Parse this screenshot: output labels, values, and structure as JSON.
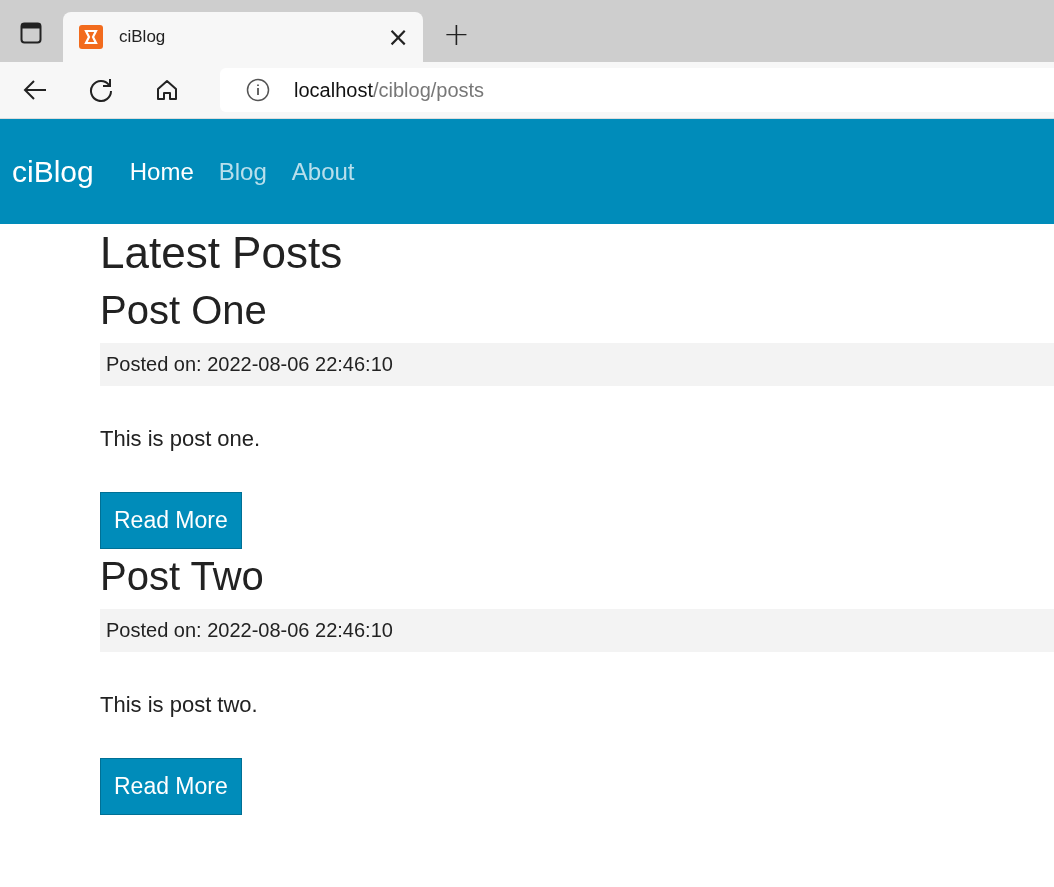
{
  "browser": {
    "tab": {
      "title": "ciBlog",
      "close": "×"
    },
    "new_tab": "+",
    "address": {
      "host": "localhost",
      "path": "/ciblog/posts"
    }
  },
  "navbar": {
    "brand": "ciBlog",
    "links": [
      {
        "label": "Home",
        "selected": true
      },
      {
        "label": "Blog",
        "selected": false
      },
      {
        "label": "About",
        "selected": false
      }
    ]
  },
  "heading": "Latest Posts",
  "posts": [
    {
      "title": "Post One",
      "posted": "Posted on: 2022-08-06 22:46:10",
      "body": "This is post one.",
      "button": "Read More"
    },
    {
      "title": "Post Two",
      "posted": "Posted on: 2022-08-06 22:46:10",
      "body": "This is post two.",
      "button": "Read More"
    }
  ]
}
